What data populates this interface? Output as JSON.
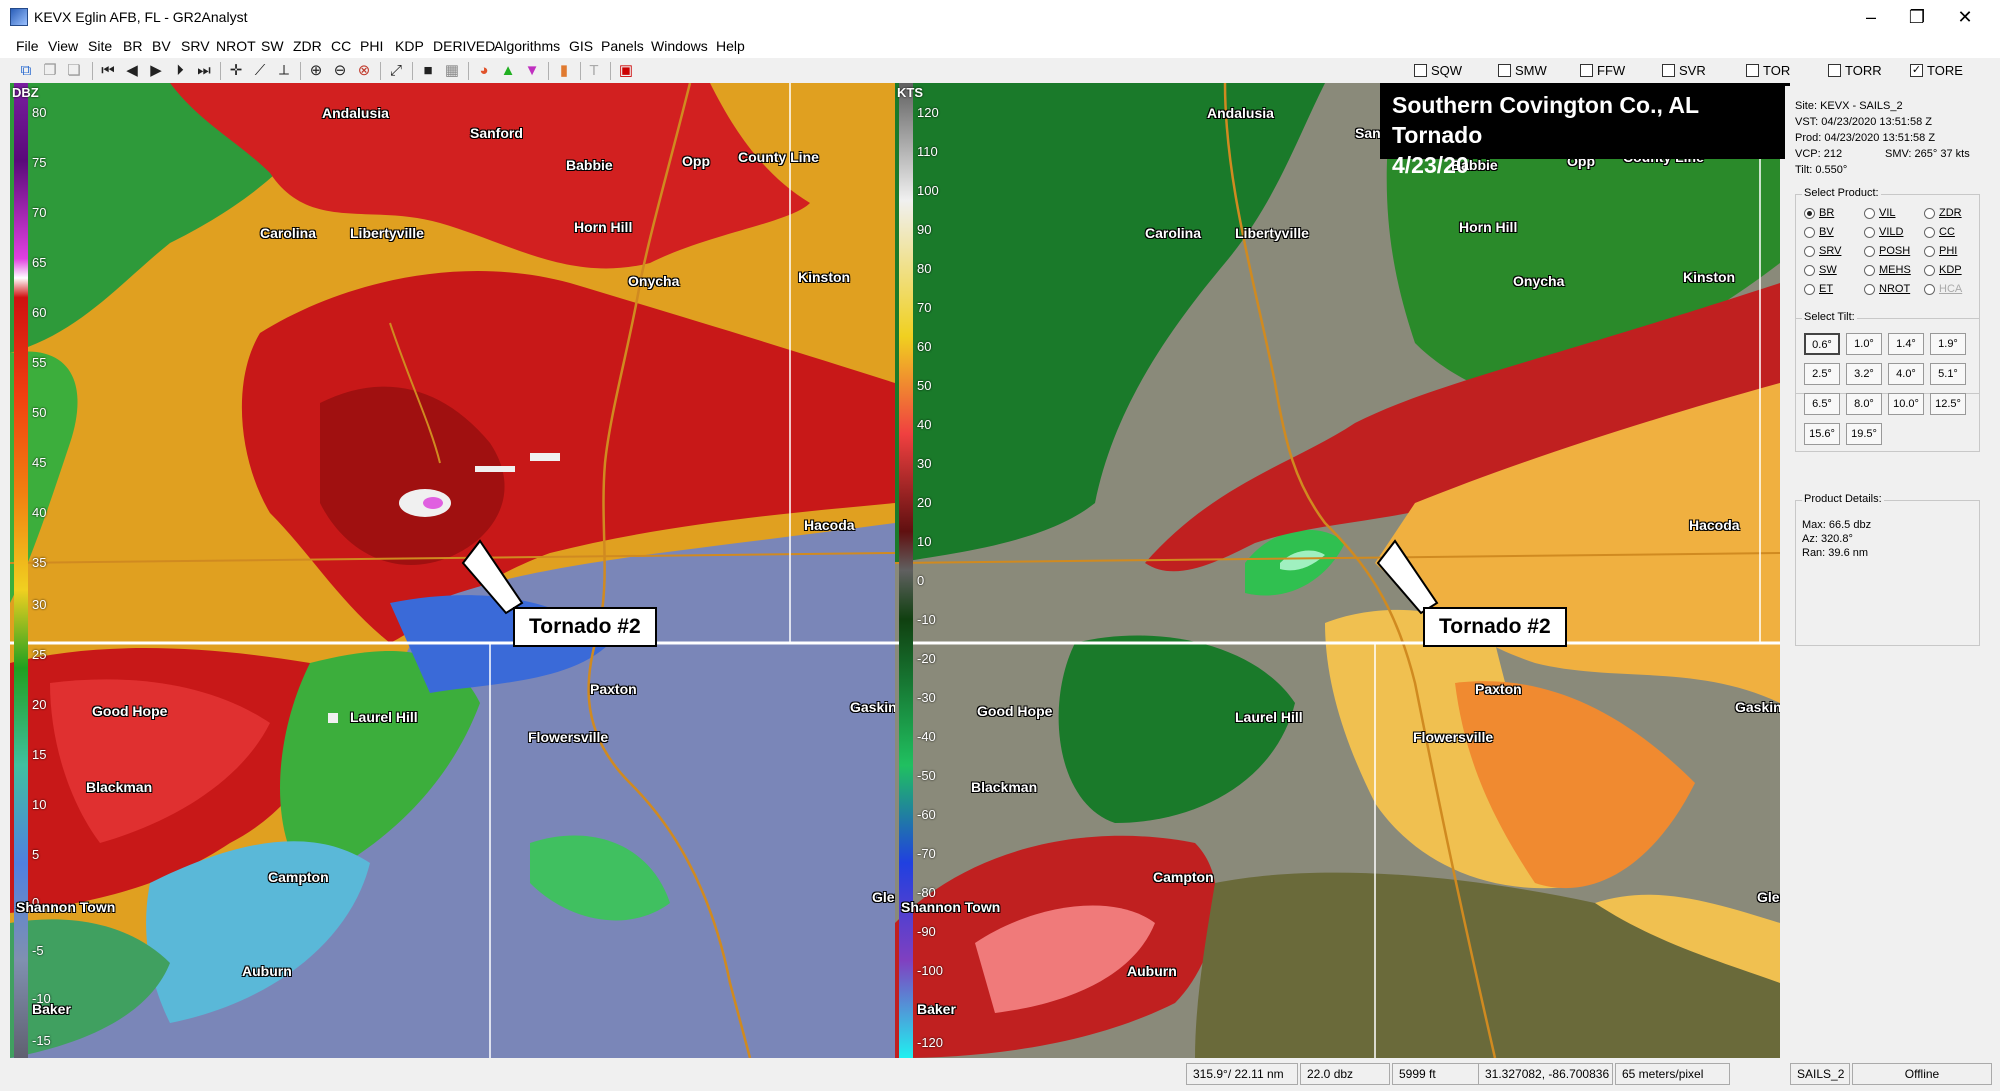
{
  "window": {
    "title": "KEVX Eglin AFB, FL - GR2Analyst",
    "controls": [
      "–",
      "❐",
      "✕"
    ]
  },
  "menu": [
    "File",
    "View",
    "Site",
    "BR",
    "BV",
    "SRV",
    "NROT",
    "SW",
    "ZDR",
    "CC",
    "PHI",
    "KDP",
    "DERIVED",
    "Algorithms",
    "GIS",
    "Panels",
    "Windows",
    "Help"
  ],
  "toolbar": {
    "icons": [
      "network-icon",
      "copy-icon",
      "paste-icon",
      "first-frame-icon",
      "prev-frame-icon",
      "play-icon",
      "next-frame-icon",
      "last-frame-icon",
      "crosshair-icon",
      "measure-icon",
      "profile-icon",
      "zoom-in-icon",
      "zoom-out-icon",
      "zoom-reset-icon",
      "pick-icon",
      "stop-icon",
      "grid-icon",
      "palette-icon",
      "up-triangle-icon",
      "down-triangle-icon",
      "bookmark-icon",
      "text-icon",
      "record-icon"
    ],
    "warnings": [
      {
        "label": "SQW",
        "checked": false
      },
      {
        "label": "SMW",
        "checked": false
      },
      {
        "label": "FFW",
        "checked": false
      },
      {
        "label": "SVR",
        "checked": false
      },
      {
        "label": "TOR",
        "checked": false
      },
      {
        "label": "TORR",
        "checked": false
      },
      {
        "label": "TORE",
        "checked": true
      }
    ]
  },
  "left_pane": {
    "unit": "DBZ",
    "scale": [
      "80",
      "75",
      "70",
      "65",
      "60",
      "55",
      "50",
      "45",
      "40",
      "35",
      "30",
      "25",
      "20",
      "15",
      "10",
      "5",
      "0",
      "-5",
      "-10",
      "-15"
    ],
    "callout": "Tornado #2"
  },
  "right_pane": {
    "unit": "KTS",
    "scale": [
      "120",
      "110",
      "100",
      "90",
      "80",
      "70",
      "60",
      "50",
      "40",
      "30",
      "20",
      "10",
      "0",
      "-10",
      "-20",
      "-30",
      "-40",
      "-50",
      "-60",
      "-70",
      "-80",
      "-90",
      "-100",
      "-110",
      "-120"
    ],
    "callout": "Tornado #2"
  },
  "cities_left": [
    "Andalusia",
    "Sanford",
    "Babbie",
    "Opp",
    "County Line",
    "Carolina",
    "Libertyville",
    "Horn Hill",
    "Onycha",
    "Kinston",
    "Hacoda",
    "Good Hope",
    "Laurel Hill",
    "Paxton",
    "Gaskin",
    "Flowersville",
    "Blackman",
    "Campton",
    "Shannon Town",
    "Auburn",
    "Baker",
    "Glendale"
  ],
  "cities_right": [
    "Andalusia",
    "Sanford",
    "Babbie",
    "Opp",
    "County Line",
    "Carolina",
    "Libertyville",
    "Horn Hill",
    "Onycha",
    "Kinston",
    "Hacoda",
    "Good Hope",
    "Laurel Hill",
    "Paxton",
    "Gaskin",
    "Flowersville",
    "Blackman",
    "Campton",
    "Shannon Town",
    "Auburn",
    "Baker",
    "Glendale"
  ],
  "event_title": {
    "line1": "Southern Covington Co., AL Tornado",
    "line2": "4/23/20"
  },
  "sidepanel": {
    "site": "Site:   KEVX - SAILS_2",
    "vst": "VST:    04/23/2020  13:51:58 Z",
    "prod": "Prod:   04/23/2020  13:51:58 Z",
    "vcp": "VCP:    212",
    "smv": "SMV:  265° 37 kts",
    "tilt": "Tilt:    0.550°",
    "select_product_label": "Select Product:",
    "products": [
      {
        "label": "BR",
        "selected": true,
        "enabled": true
      },
      {
        "label": "VIL",
        "selected": false,
        "enabled": true
      },
      {
        "label": "ZDR",
        "selected": false,
        "enabled": true
      },
      {
        "label": "BV",
        "selected": false,
        "enabled": true
      },
      {
        "label": "VILD",
        "selected": false,
        "enabled": true
      },
      {
        "label": "CC",
        "selected": false,
        "enabled": true
      },
      {
        "label": "SRV",
        "selected": false,
        "enabled": true
      },
      {
        "label": "POSH",
        "selected": false,
        "enabled": true
      },
      {
        "label": "PHI",
        "selected": false,
        "enabled": true
      },
      {
        "label": "SW",
        "selected": false,
        "enabled": true
      },
      {
        "label": "MEHS",
        "selected": false,
        "enabled": true
      },
      {
        "label": "KDP",
        "selected": false,
        "enabled": true
      },
      {
        "label": "ET",
        "selected": false,
        "enabled": true
      },
      {
        "label": "NROT",
        "selected": false,
        "enabled": true
      },
      {
        "label": "HCA",
        "selected": false,
        "enabled": false
      }
    ],
    "select_tilt_label": "Select Tilt:",
    "tilts": [
      "0.6°",
      "1.0°",
      "1.4°",
      "1.9°",
      "2.5°",
      "3.2°",
      "4.0°",
      "5.1°",
      "6.5°",
      "8.0°",
      "10.0°",
      "12.5°",
      "15.6°",
      "19.5°"
    ],
    "selected_tilt": "0.6°",
    "details_label": "Product Details:",
    "max": "Max:  66.5 dbz",
    "az": "Az:   320.8°",
    "ran": "Ran:  39.6 nm"
  },
  "statusbar": {
    "polar": "315.9°/ 22.11 nm",
    "value": "22.0 dbz",
    "height": "5999 ft",
    "coords": "31.327082, -86.700836",
    "resolution": "65 meters/pixel",
    "site": "SAILS_2",
    "status": "Offline"
  }
}
